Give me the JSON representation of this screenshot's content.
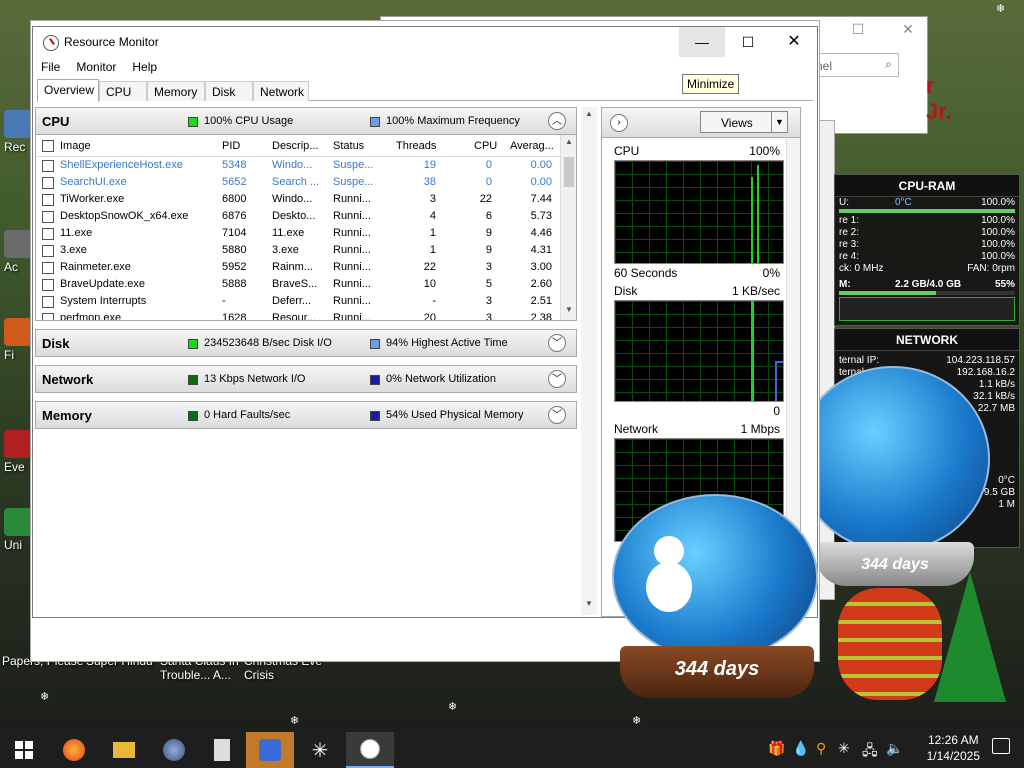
{
  "desktop": {
    "banner_text": "r Jr.",
    "bg_search_text": "nel",
    "icons": [
      {
        "label": "Rec"
      },
      {
        "label": "Ac"
      },
      {
        "label": "Fi"
      },
      {
        "label": "Eve"
      },
      {
        "label": "Uni"
      }
    ],
    "shortcut_labels": [
      "Papers, Please",
      "Super Hindu",
      "Santa Claus In Trouble... A...",
      "Christmas Eve Crisis"
    ],
    "globe_days_small": "344 days",
    "globe_days_large": "344 days"
  },
  "widget_cpu": {
    "title": "CPU-RAM",
    "rows": [
      {
        "label": "U:",
        "mid": "0°C",
        "value": "100.0%"
      },
      {
        "label": "re 1:",
        "mid": "",
        "value": "100.0%"
      },
      {
        "label": "re 2:",
        "mid": "",
        "value": "100.0%"
      },
      {
        "label": "re 3:",
        "mid": "",
        "value": "100.0%"
      },
      {
        "label": "re 4:",
        "mid": "",
        "value": "100.0%"
      },
      {
        "label": "ck: 0 MHz",
        "mid": "",
        "value": "FAN: 0rpm"
      },
      {
        "label": "M:",
        "mid": "2.2 GB/4.0 GB",
        "value": "55%"
      }
    ]
  },
  "widget_net": {
    "title": "NETWORK",
    "rows": [
      {
        "label": "ternal IP:",
        "value": "104.223.118.57"
      },
      {
        "label": "ternal",
        "value": "192.168.16.2"
      },
      {
        "label": "",
        "value": "1.1 kB/s"
      },
      {
        "label": "",
        "value": "32.1 kB/s"
      },
      {
        "label": "",
        "value": "22.7 MB"
      }
    ],
    "extra": [
      "0°C",
      "9.5 GB",
      "1 M"
    ]
  },
  "window": {
    "title": "Resource Monitor",
    "tooltip": "Minimize",
    "menu": [
      "File",
      "Monitor",
      "Help"
    ],
    "tabs": [
      "Overview",
      "CPU",
      "Memory",
      "Disk",
      "Network"
    ],
    "active_tab": "Overview"
  },
  "cpu_section": {
    "name": "CPU",
    "stat1": "100% CPU Usage",
    "stat2": "100% Maximum Frequency",
    "stat1_color": "#1fd51f",
    "stat2_color": "#6a9fe0",
    "columns": [
      "Image",
      "PID",
      "Descrip...",
      "Status",
      "Threads",
      "CPU",
      "Averag..."
    ],
    "rows": [
      {
        "image": "ShellExperienceHost.exe",
        "pid": "5348",
        "desc": "Windo...",
        "status": "Suspe...",
        "threads": "19",
        "cpu": "0",
        "avg": "0.00",
        "suspended": true
      },
      {
        "image": "SearchUI.exe",
        "pid": "5652",
        "desc": "Search ...",
        "status": "Suspe...",
        "threads": "38",
        "cpu": "0",
        "avg": "0.00",
        "suspended": true
      },
      {
        "image": "TiWorker.exe",
        "pid": "6800",
        "desc": "Windo...",
        "status": "Runni...",
        "threads": "3",
        "cpu": "22",
        "avg": "7.44",
        "suspended": false
      },
      {
        "image": "DesktopSnowOK_x64.exe",
        "pid": "6876",
        "desc": "Deskto...",
        "status": "Runni...",
        "threads": "4",
        "cpu": "6",
        "avg": "5.73",
        "suspended": false
      },
      {
        "image": "11.exe",
        "pid": "7104",
        "desc": "11.exe",
        "status": "Runni...",
        "threads": "1",
        "cpu": "9",
        "avg": "4.46",
        "suspended": false
      },
      {
        "image": "3.exe",
        "pid": "5880",
        "desc": "3.exe",
        "status": "Runni...",
        "threads": "1",
        "cpu": "9",
        "avg": "4.31",
        "suspended": false
      },
      {
        "image": "Rainmeter.exe",
        "pid": "5952",
        "desc": "Rainm...",
        "status": "Runni...",
        "threads": "22",
        "cpu": "3",
        "avg": "3.00",
        "suspended": false
      },
      {
        "image": "BraveUpdate.exe",
        "pid": "5888",
        "desc": "BraveS...",
        "status": "Runni...",
        "threads": "10",
        "cpu": "5",
        "avg": "2.60",
        "suspended": false
      },
      {
        "image": "System Interrupts",
        "pid": "-",
        "desc": "Deferr...",
        "status": "Runni...",
        "threads": "-",
        "cpu": "3",
        "avg": "2.51",
        "suspended": false
      },
      {
        "image": "perfmon.exe",
        "pid": "1628",
        "desc": "Resour...",
        "status": "Runni...",
        "threads": "20",
        "cpu": "3",
        "avg": "2.38",
        "suspended": false
      }
    ]
  },
  "disk_section": {
    "name": "Disk",
    "stat1": "234523648 B/sec Disk I/O",
    "stat2": "94% Highest Active Time",
    "stat1_color": "#1fd51f",
    "stat2_color": "#6a9fe0"
  },
  "network_section": {
    "name": "Network",
    "stat1": "13 Kbps Network I/O",
    "stat2": "0% Network Utilization",
    "stat1_color": "#0d6e0d",
    "stat2_color": "#1a1aa8"
  },
  "memory_section": {
    "name": "Memory",
    "stat1": "0 Hard Faults/sec",
    "stat2": "54% Used Physical Memory",
    "stat1_color": "#0d6e0d",
    "stat2_color": "#1a1aa8"
  },
  "graphs": {
    "views_label": "Views",
    "cpu": {
      "title": "CPU",
      "max": "100%",
      "footer_left": "60 Seconds",
      "footer_right": "0%"
    },
    "disk": {
      "title": "Disk",
      "max": "1 KB/sec",
      "footer_right": "0"
    },
    "network": {
      "title": "Network",
      "max": "1 Mbps"
    },
    "memory": {
      "title": "M"
    }
  },
  "taskbar": {
    "time": "12:26 AM",
    "date": "1/14/2025",
    "apps": [
      "start-icon",
      "firefox-icon",
      "file-explorer-icon",
      "browser-icon",
      "notepad-icon",
      "snow-app-icon",
      "snowflake-icon",
      "resource-monitor-icon"
    ]
  }
}
